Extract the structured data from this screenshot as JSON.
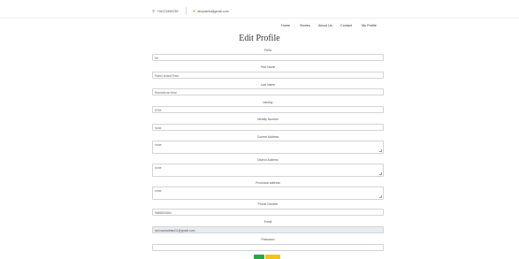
{
  "header": {
    "phone": "+94123456789",
    "email": "abcpatels@gmail.com",
    "phone_icon": "phone-icon",
    "email_icon": "envelope-icon"
  },
  "nav": {
    "items": [
      "Home",
      "Stories",
      "About Us",
      "Contact",
      "My Profile"
    ]
  },
  "page": {
    "title": "Edit Profile"
  },
  "form": {
    "prefix_label": "Prefix",
    "prefix_value": "Mr",
    "first_name_label": "First Name",
    "first_name_value": "Rahul anand Ravi",
    "last_name_label": "Last Name",
    "last_name_value": "Ravindhran bhai",
    "identity_label": "Identity",
    "identity_value": "8764",
    "identity_number_label": "Identity Number",
    "identity_number_value": "none",
    "current_address_label": "Current Address",
    "current_address_value": "none",
    "district_address_label": "District Address",
    "district_address_value": "none",
    "provincial_address_label": "Provincial address",
    "provincial_address_value": "none",
    "phone_number_label": "Phone Number",
    "phone_number_value": "9865830684",
    "email_label": "Email",
    "email_value": "ravi.samadhani11@gmail.com",
    "password_label": "Password",
    "password_value": ""
  },
  "colors": {
    "save_button": "#28a745",
    "cancel_button": "#f0c419",
    "readonly_field": "#e9ecef"
  }
}
